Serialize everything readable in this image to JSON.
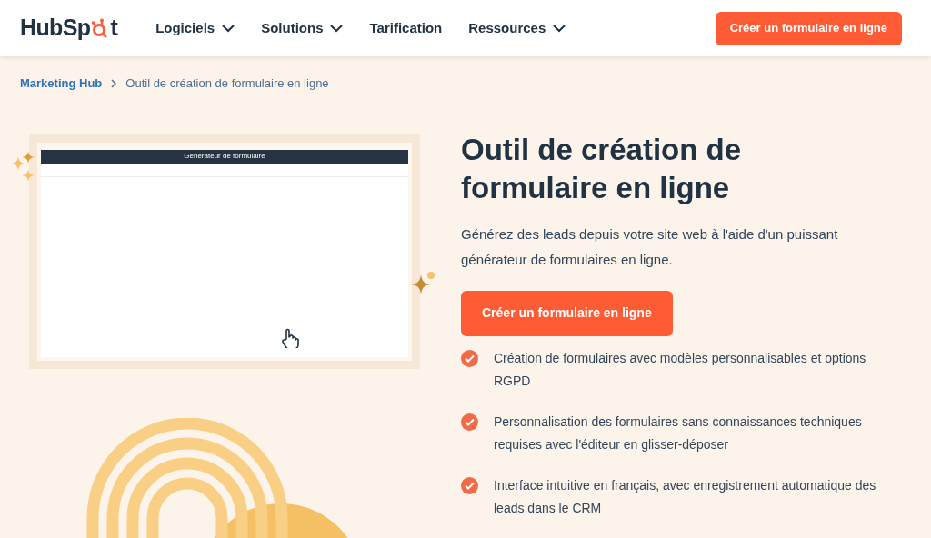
{
  "header": {
    "logo_parts": [
      "HubSp",
      "t"
    ],
    "nav": [
      {
        "label": "Logiciels",
        "dropdown": true
      },
      {
        "label": "Solutions",
        "dropdown": true
      },
      {
        "label": "Tarification",
        "dropdown": false
      },
      {
        "label": "Ressources",
        "dropdown": true
      }
    ],
    "cta": "Créer un formulaire en ligne"
  },
  "breadcrumb": {
    "link": "Marketing Hub",
    "current": "Outil de création de formulaire en ligne"
  },
  "preview": {
    "title": "Générateur de formulaire"
  },
  "hero": {
    "title": "Outil de création de formulaire en ligne",
    "subtitle": "Générez des leads depuis votre site web à l'aide d'un puissant générateur de formulaires en ligne.",
    "button": "Créer un formulaire en ligne",
    "features": [
      "Création de formulaires avec modèles personnalisables et options RGPD",
      "Personnalisation des formulaires sans connaissances techniques requises avec l'éditeur en glisser-déposer",
      "Interface intuitive en français, avec enregistrement automatique des leads dans le CRM"
    ]
  }
}
